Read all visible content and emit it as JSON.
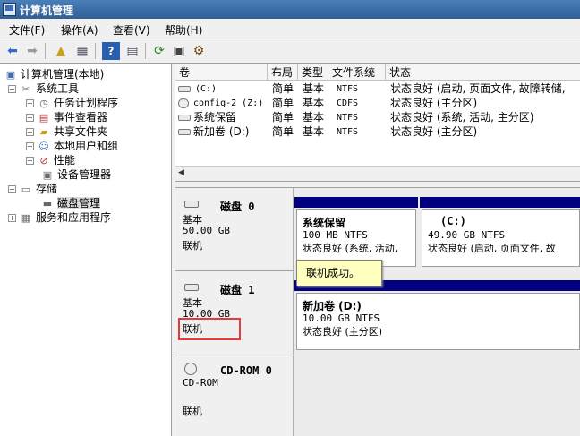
{
  "window": {
    "title": "计算机管理"
  },
  "menu": [
    "文件(F)",
    "操作(A)",
    "查看(V)",
    "帮助(H)"
  ],
  "toolbar": {
    "icons": [
      "back-arrow-icon",
      "forward-arrow-icon",
      "up-folder-icon",
      "show-hide-tree-icon",
      "help-icon",
      "properties-icon",
      "refresh-icon",
      "export-icon",
      "settings-icon"
    ]
  },
  "tree": {
    "root": "计算机管理(本地)",
    "system_tools": "系统工具",
    "task_scheduler": "任务计划程序",
    "event_viewer": "事件查看器",
    "shared_folders": "共享文件夹",
    "local_users": "本地用户和组",
    "performance": "性能",
    "device_manager": "设备管理器",
    "storage": "存储",
    "disk_management": "磁盘管理",
    "services_apps": "服务和应用程序"
  },
  "list": {
    "columns": [
      "卷",
      "布局",
      "类型",
      "文件系统",
      "状态"
    ],
    "rows": [
      {
        "volume": "(C:)",
        "layout": "简单",
        "type": "基本",
        "fs": "NTFS",
        "status": "状态良好 (启动, 页面文件, 故障转储,"
      },
      {
        "volume": "config-2 (Z:)",
        "layout": "简单",
        "type": "基本",
        "fs": "CDFS",
        "status": "状态良好 (主分区)"
      },
      {
        "volume": "系统保留",
        "layout": "简单",
        "type": "基本",
        "fs": "NTFS",
        "status": "状态良好 (系统, 活动, 主分区)"
      },
      {
        "volume": "新加卷 (D:)",
        "layout": "简单",
        "type": "基本",
        "fs": "NTFS",
        "status": "状态良好 (主分区)"
      }
    ]
  },
  "disks": [
    {
      "name": "磁盘 0",
      "type": "基本",
      "size": "50.00 GB",
      "state": "联机",
      "partitions": [
        {
          "title": "系统保留",
          "size": "100 MB NTFS",
          "status": "状态良好 (系统, 活动,"
        },
        {
          "title": "(C:)",
          "size": "49.90 GB NTFS",
          "status": "状态良好 (启动, 页面文件, 故"
        }
      ]
    },
    {
      "name": "磁盘 1",
      "type": "基本",
      "size": "10.00 GB",
      "state": "联机",
      "partitions": [
        {
          "title": "新加卷 (D:)",
          "size": "10.00 GB NTFS",
          "status": "状态良好 (主分区)"
        }
      ]
    },
    {
      "name": "CD-ROM 0",
      "type": "CD-ROM",
      "state": "联机"
    }
  ],
  "tooltip": "联机成功。",
  "colors": {
    "titlebar": "#3a6ea8",
    "partition_header": "#000080",
    "highlight": "#e23b3b",
    "tooltip_bg": "#ffffc0"
  }
}
